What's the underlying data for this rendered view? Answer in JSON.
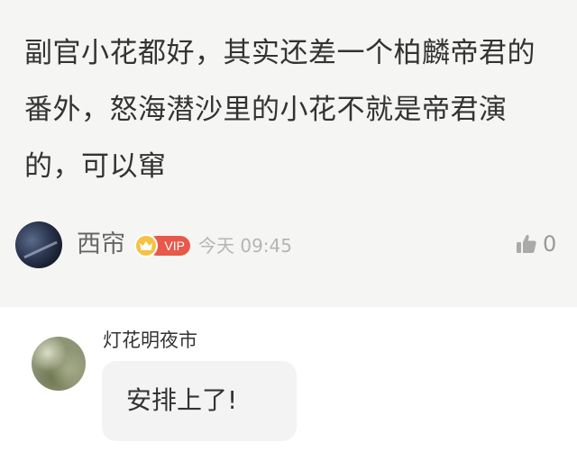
{
  "post": {
    "text": "副官小花都好，其实还差一个柏麟帝君的番外，怒海潜沙里的小花不就是帝君演的，可以窜",
    "author": "西帘",
    "vip_label": "VIP",
    "timestamp": "今天 09:45",
    "like_count": "0",
    "like_icon": "thumbs-up-icon"
  },
  "reply": {
    "author": "灯花明夜市",
    "text": "安排上了!"
  },
  "colors": {
    "post_background": "#f5f5f3",
    "vip_red": "#e8584b",
    "vip_gold": "#f6c243",
    "bubble_background": "#f3f3f3"
  }
}
